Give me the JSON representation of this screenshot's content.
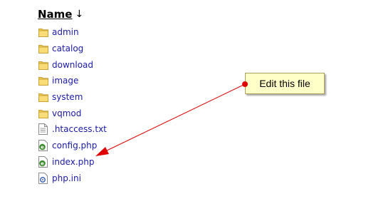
{
  "header": {
    "name_label": "Name",
    "sort_indicator": "↓"
  },
  "files": [
    {
      "name": "admin",
      "type": "folder"
    },
    {
      "name": "catalog",
      "type": "folder"
    },
    {
      "name": "download",
      "type": "folder"
    },
    {
      "name": "image",
      "type": "folder"
    },
    {
      "name": "system",
      "type": "folder"
    },
    {
      "name": "vqmod",
      "type": "folder"
    },
    {
      "name": ".htaccess.txt",
      "type": "text-file"
    },
    {
      "name": "config.php",
      "type": "php-file"
    },
    {
      "name": "index.php",
      "type": "php-file"
    },
    {
      "name": "php.ini",
      "type": "ini-file"
    }
  ],
  "annotation": {
    "callout_text": "Edit this file",
    "arrow_color": "#e00000",
    "points_to": "index.php"
  },
  "colors": {
    "link": "#1a1aa6",
    "callout_bg": "#ffffc8",
    "folder": "#f2c94c",
    "arrow": "#e00000"
  }
}
